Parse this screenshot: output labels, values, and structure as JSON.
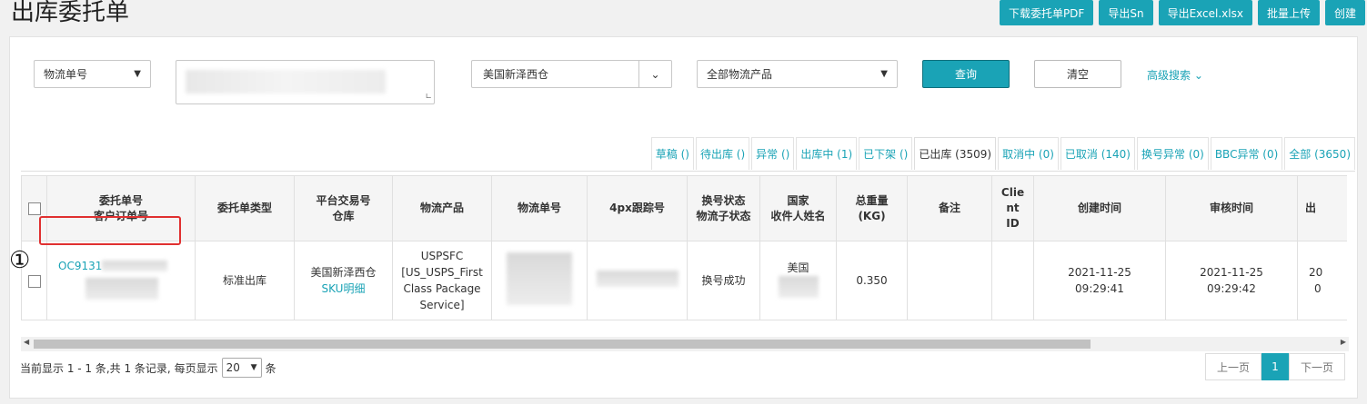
{
  "page": {
    "title": "出库委托单"
  },
  "actions": [
    "下载委托单PDF",
    "导出Sn",
    "导出Excel.xlsx",
    "批量上传",
    "创建"
  ],
  "filters": {
    "search_type": "物流单号",
    "warehouse": "美国新泽西仓",
    "product": "全部物流产品",
    "query_label": "查询",
    "clear_label": "清空",
    "advanced_label": "高级搜索"
  },
  "tabs": [
    "草稿 ()",
    "待出库 ()",
    "异常 ()",
    "出库中 (1)",
    "已下架 ()",
    "已出库 (3509)",
    "取消中 (0)",
    "已取消 (140)",
    "换号异常 (0)",
    "BBC异常 (0)",
    "全部 (3650)"
  ],
  "table": {
    "headers": [
      [
        "委托单号",
        "客户订单号"
      ],
      [
        "委托单类型"
      ],
      [
        "平台交易号",
        "仓库"
      ],
      [
        "物流产品"
      ],
      [
        "物流单号"
      ],
      [
        "4px跟踪号"
      ],
      [
        "换号状态",
        "物流子状态"
      ],
      [
        "国家",
        "收件人姓名"
      ],
      [
        "总重量",
        "(KG)"
      ],
      [
        "备注"
      ],
      [
        "Clie",
        "nt",
        "ID"
      ],
      [
        "创建时间"
      ],
      [
        "审核时间"
      ],
      [
        "出"
      ]
    ],
    "row": {
      "order_no": "OC9131",
      "type": "标准出库",
      "warehouse": "美国新泽西仓",
      "sku_link": "SKU明细",
      "product": "USPSFC [US_USPS_First Class Package Service]",
      "swap_status": "换号成功",
      "country": "美国",
      "weight": "0.350",
      "created_date": "2021-11-25",
      "created_time": "09:29:41",
      "audit_date": "2021-11-25",
      "audit_time": "09:29:42",
      "out_partial_1": "20",
      "out_partial_2": "0"
    }
  },
  "annotation": "①",
  "footer": {
    "summary_prefix": "当前显示 1 - 1 条,共 1 条记录, 每页显示",
    "page_size": "20",
    "summary_suffix": "条",
    "prev": "上一页",
    "current": "1",
    "next": "下一页"
  }
}
